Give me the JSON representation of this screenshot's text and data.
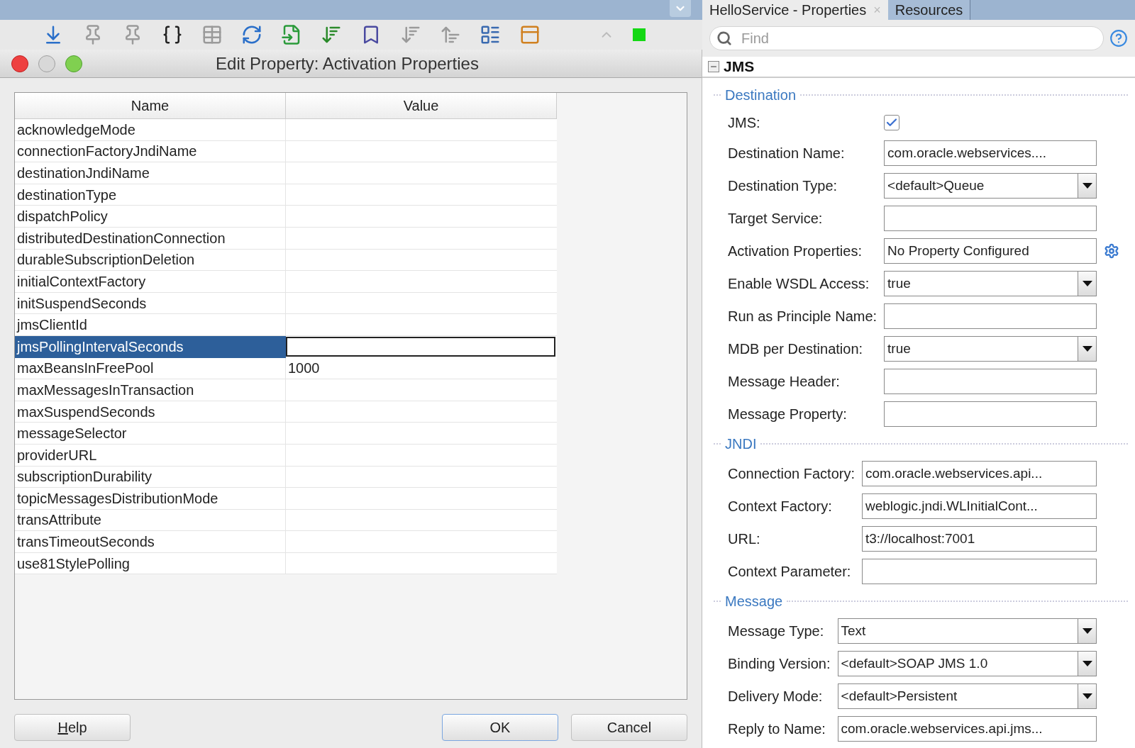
{
  "dialog": {
    "title": "Edit Property: Activation Properties",
    "table": {
      "columns": [
        "Name",
        "Value"
      ],
      "rows": [
        {
          "name": "acknowledgeMode",
          "selected": false
        },
        {
          "name": "connectionFactoryJndiName",
          "selected": false
        },
        {
          "name": "destinationJndiName",
          "selected": false
        },
        {
          "name": "destinationType",
          "selected": false
        },
        {
          "name": "dispatchPolicy",
          "selected": false
        },
        {
          "name": "distributedDestinationConnection",
          "selected": false
        },
        {
          "name": "durableSubscriptionDeletion",
          "selected": false
        },
        {
          "name": "initialContextFactory",
          "selected": false
        },
        {
          "name": "initSuspendSeconds",
          "selected": false
        },
        {
          "name": "jmsClientId",
          "selected": false
        },
        {
          "name": "jmsPollingIntervalSeconds",
          "selected": true
        },
        {
          "name": "maxBeansInFreePool",
          "value": "1000",
          "selected": false
        },
        {
          "name": "maxMessagesInTransaction",
          "selected": false
        },
        {
          "name": "maxSuspendSeconds",
          "selected": false
        },
        {
          "name": "messageSelector",
          "selected": false
        },
        {
          "name": "providerURL",
          "selected": false
        },
        {
          "name": "subscriptionDurability",
          "selected": false
        },
        {
          "name": "topicMessagesDistributionMode",
          "selected": false
        },
        {
          "name": "transAttribute",
          "selected": false
        },
        {
          "name": "transTimeoutSeconds",
          "selected": false
        },
        {
          "name": "use81StylePolling",
          "selected": false
        }
      ]
    },
    "buttons": [
      {
        "label": "Help",
        "mnemonic": true,
        "default": false
      },
      {
        "label": "OK",
        "default": true
      },
      {
        "label": "Cancel",
        "default": false
      }
    ]
  },
  "properties": {
    "tabs": [
      {
        "label": "HelloService - Properties",
        "close": "×",
        "selected": true
      },
      {
        "label": "Resources",
        "selected": false
      }
    ],
    "search": {
      "placeholder": "Find"
    },
    "group": "JMS",
    "sections": [
      {
        "title": "Destination",
        "fields": [
          {
            "kind": "checkbox",
            "label": "JMS:",
            "checked": true
          },
          {
            "kind": "text",
            "label": "Destination Name:",
            "value": "com.oracle.webservices...."
          },
          {
            "kind": "select",
            "label": "Destination Type:",
            "value": "<default>Queue"
          },
          {
            "kind": "text",
            "label": "Target Service:"
          },
          {
            "kind": "gear",
            "label": "Activation Properties:",
            "value": "No Property Configured"
          },
          {
            "kind": "select",
            "label": "Enable WSDL Access:",
            "value": "true"
          },
          {
            "kind": "text",
            "label": "Run as Principle Name:"
          },
          {
            "kind": "select",
            "label": "MDB per Destination:",
            "value": "true"
          },
          {
            "kind": "text",
            "label": "Message Header:"
          },
          {
            "kind": "text",
            "label": "Message Property:"
          }
        ]
      },
      {
        "title": "JNDI",
        "fields": [
          {
            "kind": "text",
            "label": "Connection Factory:",
            "value": "com.oracle.webservices.api..."
          },
          {
            "kind": "text",
            "label": "Context Factory:",
            "value": "weblogic.jndi.WLInitialCont..."
          },
          {
            "kind": "text",
            "label": "URL:",
            "value": "t3://localhost:7001"
          },
          {
            "kind": "text",
            "label": "Context Parameter:"
          }
        ]
      },
      {
        "title": "Message",
        "fields": [
          {
            "kind": "select",
            "label": "Message Type:",
            "value": "Text"
          },
          {
            "kind": "select",
            "label": "Binding Version:",
            "value": "<default>SOAP JMS 1.0"
          },
          {
            "kind": "select",
            "label": "Delivery Mode:",
            "value": "<default>Persistent"
          },
          {
            "kind": "text",
            "label": "Reply to Name:",
            "value": "com.oracle.webservices.api.jms..."
          }
        ]
      }
    ]
  }
}
